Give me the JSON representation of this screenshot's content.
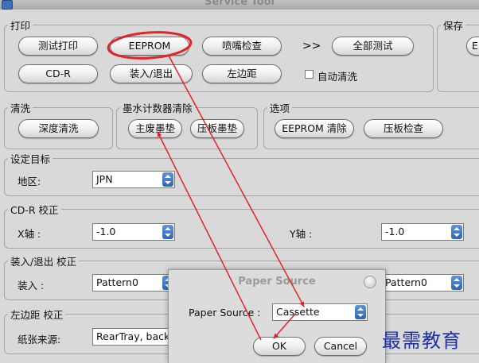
{
  "window": {
    "title": "Service Tool"
  },
  "print_group": {
    "legend": "打印",
    "buttons": [
      "测试打印",
      "EEPROM",
      "喷嘴检查",
      "全部测试",
      "CD-R",
      "装入/退出",
      "左边距"
    ],
    "arrows": ">>",
    "auto_clean_label": "自动清洗"
  },
  "save_group": {
    "legend": "保存",
    "button": "E"
  },
  "clean_group": {
    "legend": "清洗",
    "button": "深度清洗"
  },
  "ink_counter_group": {
    "legend": "墨水计数器清除",
    "buttons": [
      "主废墨垫",
      "压板墨垫"
    ]
  },
  "options_group": {
    "legend": "选项",
    "buttons": [
      "EEPROM 清除",
      "压板检查"
    ]
  },
  "target_group": {
    "legend": "设定目标",
    "region_label": "地区:",
    "region_value": "JPN"
  },
  "cdr_group": {
    "legend": "CD-R 校正",
    "x_label": "X轴 :",
    "x_value": "-1.0",
    "y_label": "Y轴 :",
    "y_value": "-1.0"
  },
  "loadeject_group": {
    "legend": "装入/退出 校正",
    "load_label": "装入 :",
    "load_value": "Pattern0",
    "right_value": "Pattern0"
  },
  "leftmargin_group": {
    "legend": "左边距 校正",
    "source_label": "纸张来源:",
    "source_value": "RearTray, back"
  },
  "paper_source_dialog": {
    "title": "Paper Source",
    "field_label": "Paper Source :",
    "field_value": "Cassette",
    "ok_label": "OK",
    "cancel_label": "Cancel"
  },
  "watermark": "最需教育",
  "annotation_color": "#e0242a"
}
